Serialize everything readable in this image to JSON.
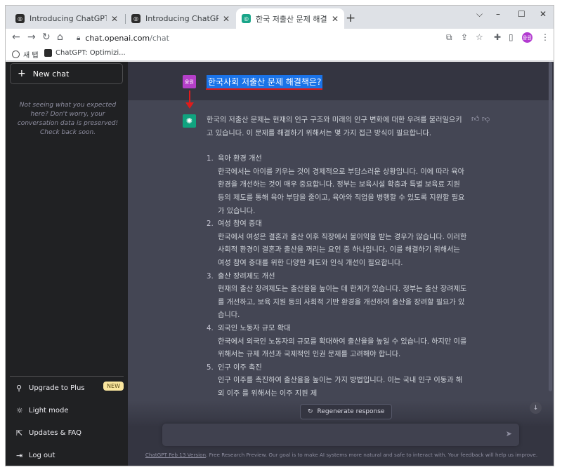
{
  "browser": {
    "tabs": [
      {
        "title": "Introducing ChatGPT",
        "active": false
      },
      {
        "title": "Introducing ChatGPT",
        "active": false
      },
      {
        "title": "한국 저출산 문제 해결책",
        "active": true
      }
    ],
    "new_tab": "+",
    "window_controls": {
      "minimize": "–",
      "maximize": "☐",
      "close": "✕",
      "dropdown": "⌵"
    },
    "url_host": "chat.openai.com",
    "url_path": "/chat",
    "profile_initials": "융원",
    "bookmarks": [
      {
        "label": "새 탭"
      },
      {
        "label": "ChatGPT: Optimizi..."
      }
    ]
  },
  "sidebar": {
    "new_chat_label": "New chat",
    "note": "Not seeing what you expected here? Don't worry, your conversation data is preserved! Check back soon.",
    "items": [
      {
        "label": "Upgrade to Plus",
        "icon": "user-icon",
        "glyph": "⚲",
        "badge": "NEW"
      },
      {
        "label": "Light mode",
        "icon": "sun-icon",
        "glyph": "☼"
      },
      {
        "label": "Updates & FAQ",
        "icon": "external-link-icon",
        "glyph": "⇱"
      },
      {
        "label": "Log out",
        "icon": "logout-icon",
        "glyph": "⇥"
      }
    ]
  },
  "conversation": {
    "user_avatar_text": "융원",
    "user_message": "한국사회 저출산 문제 해결책은?",
    "answer_intro": "한국의 저출산 문제는 현재의 인구 구조와 미래의 인구 변화에 대한 우려를 불러일으키고 있습니다. 이 문제를 해결하기 위해서는 몇 가지 접근 방식이 필요합니다.",
    "answer_items": [
      {
        "num": "1.",
        "title": "육아 환경 개선",
        "body": "한국에서는 아이를 키우는 것이 경제적으로 부담스러운 상황입니다. 이에 따라 육아 환경을 개선하는 것이 매우 중요합니다. 정부는 보육시설 확충과 특별 보육료 지원 등의 제도를 통해 육아 부담을 줄이고, 육아와 직업을 병행할 수 있도록 지원할 필요가 있습니다."
      },
      {
        "num": "2.",
        "title": "여성 참여 증대",
        "body": "한국에서 여성은 결혼과 출산 이후 직장에서 불이익을 받는 경우가 많습니다. 이러한 사회적 환경이 결혼과 출산을 꺼리는 요인 중 하나입니다. 이를 해결하기 위해서는 여성 참여 증대를 위한 다양한 제도와 인식 개선이 필요합니다."
      },
      {
        "num": "3.",
        "title": "출산 장려제도 개선",
        "body": "현재의 출산 장려제도는 출산율을 높이는 데 한계가 있습니다. 정부는 출산 장려제도를 개선하고, 보육 지원 등의 사회적 기반 환경을 개선하여 출산을 장려할 필요가 있습니다."
      },
      {
        "num": "4.",
        "title": "외국인 노동자 규모 확대",
        "body": "한국에서 외국인 노동자의 규모를 확대하여 출산율을 높일 수 있습니다. 하지만 이를 위해서는 규제 개선과 국제적인 인권 문제를 고려해야 합니다."
      },
      {
        "num": "5.",
        "title": "인구 이주 촉진",
        "body": "인구 이주를 촉진하여 출산율을 높이는 가지 방법입니다. 이는 국내 인구 이동과 해외 이주 를 위해서는 이주 지원 제"
      }
    ],
    "regenerate_label": "Regenerate response",
    "footer_link": "ChatGPT Feb 13 Version",
    "footer_text": ". Free Research Preview. Our goal is to make AI systems more natural and safe to interact with. Your feedback will help us improve."
  }
}
